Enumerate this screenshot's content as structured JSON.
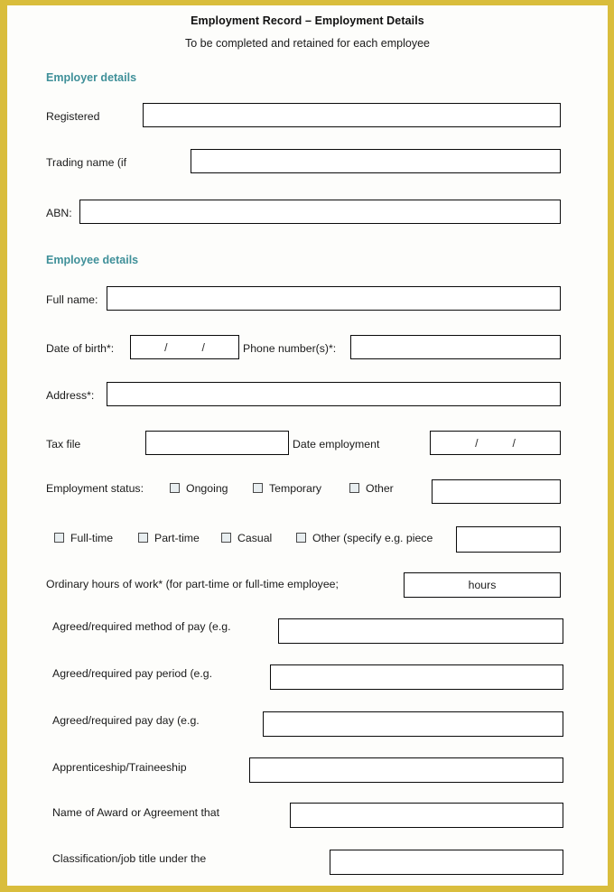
{
  "document": {
    "title": "Employment Record – Employment Details",
    "subtitle": "To be completed and retained for each employee"
  },
  "colors": {
    "page_border": "#d9bd3c",
    "section_heading": "#3f9099",
    "field_border": "#0a0a0a",
    "checkbox_fill": "#e8eef0",
    "text": "#1a1a1a",
    "page_background": "#fdfdfb"
  },
  "sections": {
    "employer": {
      "heading": "Employer details",
      "fields": [
        {
          "label": "Registered",
          "value": ""
        },
        {
          "label": "Trading name (if",
          "value": ""
        },
        {
          "label": "ABN:",
          "value": ""
        }
      ]
    },
    "employee": {
      "heading": "Employee details",
      "fields": {
        "full_name": {
          "label": "Full name:",
          "value": ""
        },
        "date_of_birth": {
          "label": "Date of birth*:",
          "value": "",
          "separator_1": "/",
          "separator_2": "/"
        },
        "phone": {
          "label": "Phone number(s)*:",
          "value": ""
        },
        "address": {
          "label": "Address*:",
          "value": ""
        },
        "tax_file": {
          "label": "Tax file",
          "value": ""
        },
        "date_employment": {
          "label": "Date employment",
          "value": "",
          "separator_1": "/",
          "separator_2": "/"
        },
        "employment_status": {
          "label": "Employment status:",
          "options": [
            {
              "label": "Ongoing",
              "checked": false
            },
            {
              "label": "Temporary",
              "checked": false
            },
            {
              "label": "Other",
              "checked": false
            }
          ],
          "other_value": ""
        },
        "employment_type": {
          "options": [
            {
              "label": "Full-time",
              "checked": false
            },
            {
              "label": "Part-time",
              "checked": false
            },
            {
              "label": "Casual",
              "checked": false
            },
            {
              "label": "Other (specify e.g. piece",
              "checked": false
            }
          ],
          "other_value": ""
        },
        "ordinary_hours": {
          "label": "Ordinary hours of work* (for part-time or full-time employee;",
          "value": "",
          "unit": "hours"
        },
        "method_of_pay": {
          "label": "Agreed/required method of pay (e.g.",
          "value": ""
        },
        "pay_period": {
          "label": "Agreed/required pay period (e.g.",
          "value": ""
        },
        "pay_day": {
          "label": "Agreed/required pay day (e.g.",
          "value": ""
        },
        "apprenticeship": {
          "label": "Apprenticeship/Traineeship",
          "value": ""
        },
        "award_name": {
          "label": "Name of Award or Agreement that",
          "value": ""
        },
        "classification": {
          "label": "Classification/job title under the",
          "value": ""
        }
      }
    }
  }
}
